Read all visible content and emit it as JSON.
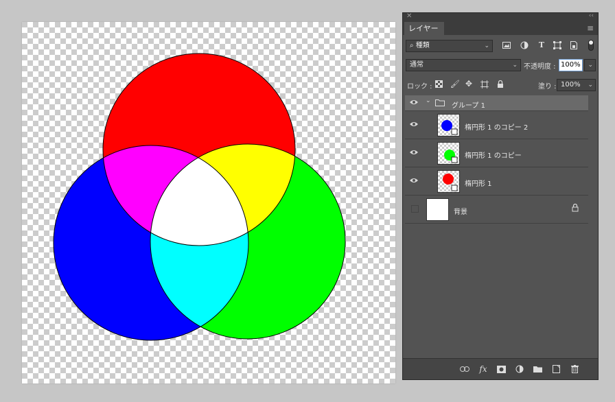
{
  "panel": {
    "close_glyph": "✕",
    "collapse_glyph": "‹‹",
    "tab_label": "レイヤー",
    "menu_glyph": "≡"
  },
  "filter": {
    "kind_label": "種類",
    "icons": [
      "image-filter-icon",
      "adjustment-filter-icon",
      "type-filter-icon",
      "shape-filter-icon",
      "smart-object-filter-icon"
    ]
  },
  "blend": {
    "mode": "通常",
    "opacity_label": "不透明度 :",
    "opacity_value": "100%"
  },
  "lock": {
    "label": "ロック :",
    "fill_label": "塗り :",
    "fill_value": "100%"
  },
  "layers": [
    {
      "name": "グループ 1",
      "type": "group",
      "visible": true,
      "expanded": true
    },
    {
      "name": "楕円形 1 のコピー 2",
      "type": "shape",
      "color": "#0000ff",
      "visible": true
    },
    {
      "name": "楕円形 1 のコピー",
      "type": "shape",
      "color": "#00ff00",
      "visible": true
    },
    {
      "name": "楕円形 1",
      "type": "shape",
      "color": "#ff0000",
      "visible": true
    },
    {
      "name": "背景",
      "type": "background",
      "color": "#ffffff",
      "visible": false,
      "locked": true
    }
  ],
  "bottom_icons": [
    "link-layers-icon",
    "fx-icon",
    "add-mask-icon",
    "new-adjustment-icon",
    "new-group-icon",
    "new-layer-icon",
    "delete-layer-icon"
  ],
  "colors": {
    "red": "#ff0000",
    "green": "#00ff00",
    "blue": "#0000ff",
    "yellow": "#ffff00",
    "magenta": "#ff00ff",
    "cyan": "#00ffff",
    "white": "#ffffff",
    "panel_bg": "#535353",
    "app_bg": "#c6c6c6"
  }
}
